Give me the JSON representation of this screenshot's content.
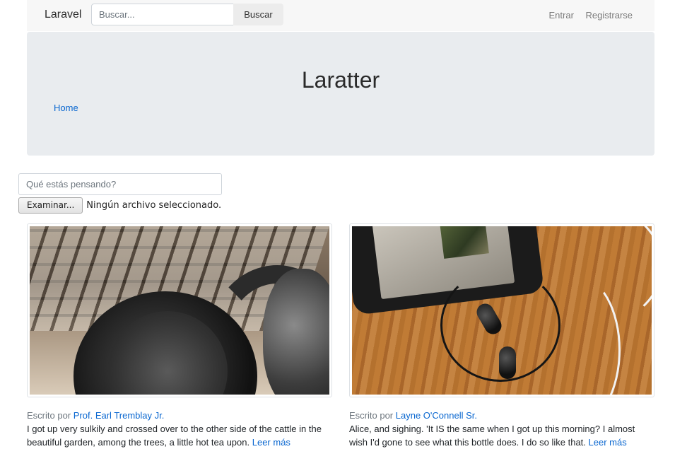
{
  "navbar": {
    "brand": "Laravel",
    "search_placeholder": "Buscar...",
    "search_button": "Buscar",
    "login": "Entrar",
    "register": "Registrarse"
  },
  "jumbotron": {
    "title": "Laratter",
    "breadcrumb": "Home"
  },
  "post_form": {
    "placeholder": "Qué estás pensando?",
    "file_button": "Examinar...",
    "file_status": "Ningún archivo seleccionado."
  },
  "posts": [
    {
      "written_by": "Escrito por",
      "author": "Prof. Earl Tremblay Jr.",
      "text": "I got up very sulkily and crossed over to the other side of the cattle in the beautiful garden, among the trees, a little hot tea upon.",
      "read_more": "Leer más"
    },
    {
      "written_by": "Escrito por",
      "author": "Layne O'Connell Sr.",
      "text": "Alice, and sighing. 'It IS the same when I got up this morning? I almost wish I'd gone to see what this bottle does. I do so like that.",
      "read_more": "Leer más"
    }
  ]
}
